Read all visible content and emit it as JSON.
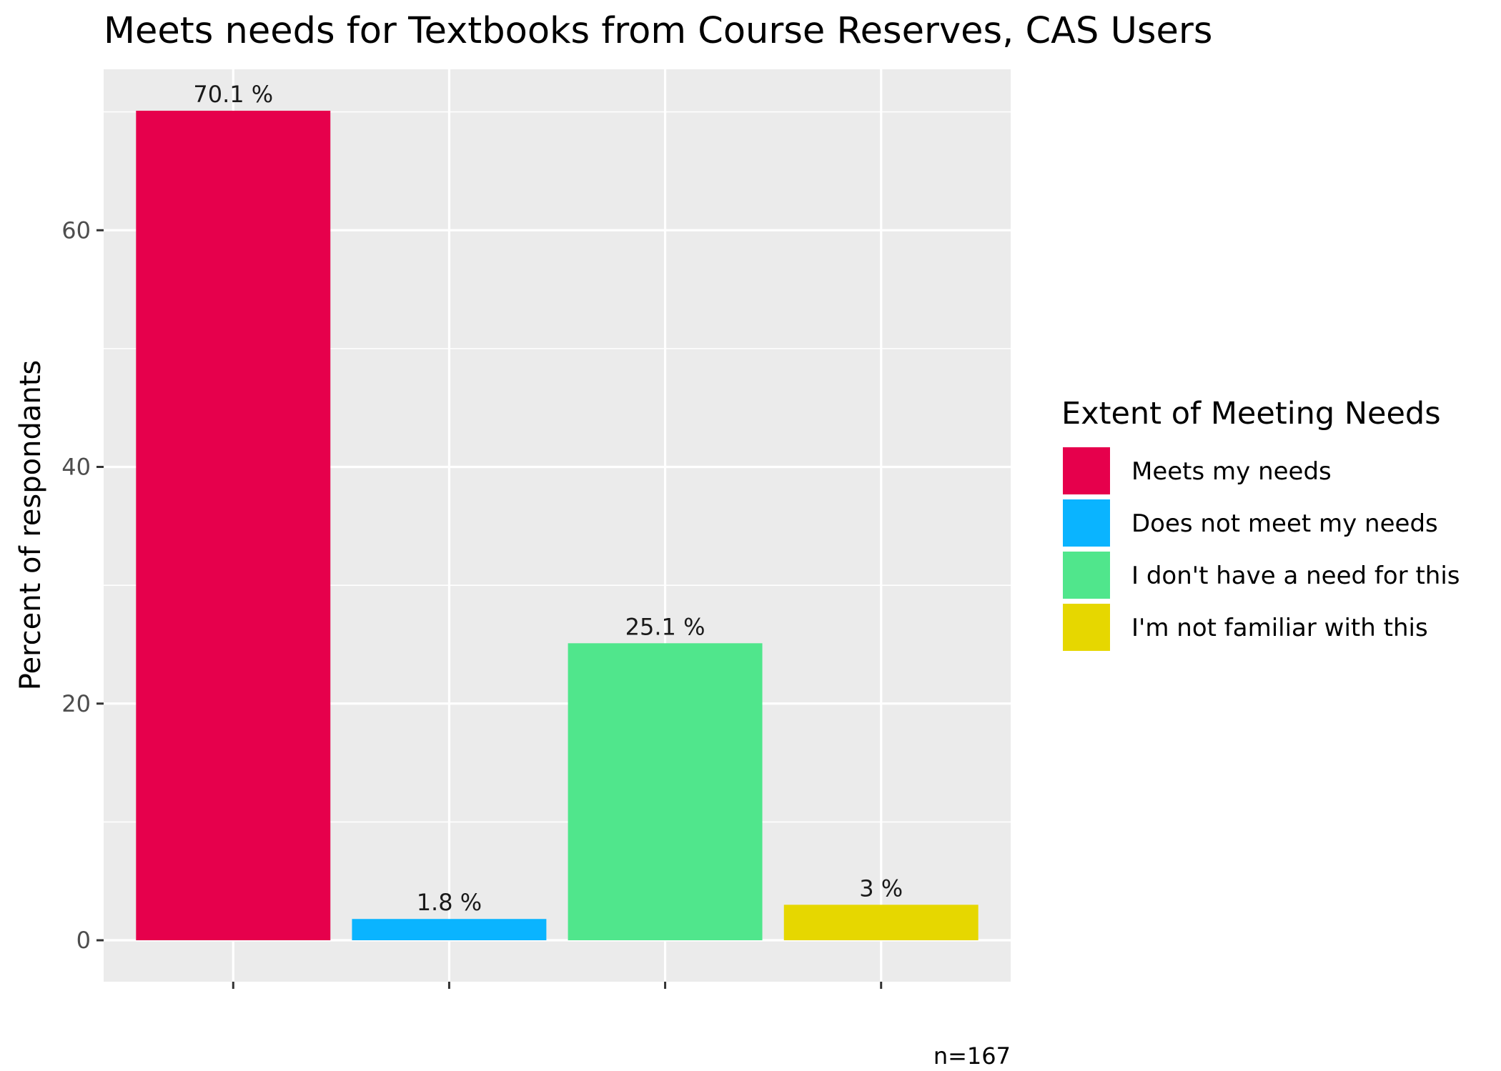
{
  "chart_data": {
    "type": "bar",
    "title": "Meets needs for Textbooks from Course Reserves, CAS Users",
    "xlabel": "",
    "ylabel": "Percent of respondants",
    "caption": "n=167",
    "categories": [
      "Meets my needs",
      "Does not meet my needs",
      "I don't have a need for this",
      "I'm not familiar with this"
    ],
    "values": [
      70.1,
      1.8,
      25.1,
      3
    ],
    "value_labels": [
      "70.1 %",
      "1.8 %",
      "25.1 %",
      "3 %"
    ],
    "colors": [
      "#e6004c",
      "#0ab4ff",
      "#50e68c",
      "#e6d700"
    ],
    "yticks": [
      0,
      20,
      40,
      60
    ],
    "ylim": [
      -3.5,
      73.6
    ],
    "grid": true,
    "background": "#ebebeb",
    "legend": {
      "title": "Extent of Meeting Needs",
      "position": "right",
      "entries": [
        "Meets my needs",
        "Does not meet my needs",
        "I don't have a need for this",
        "I'm not familiar with this"
      ]
    }
  }
}
